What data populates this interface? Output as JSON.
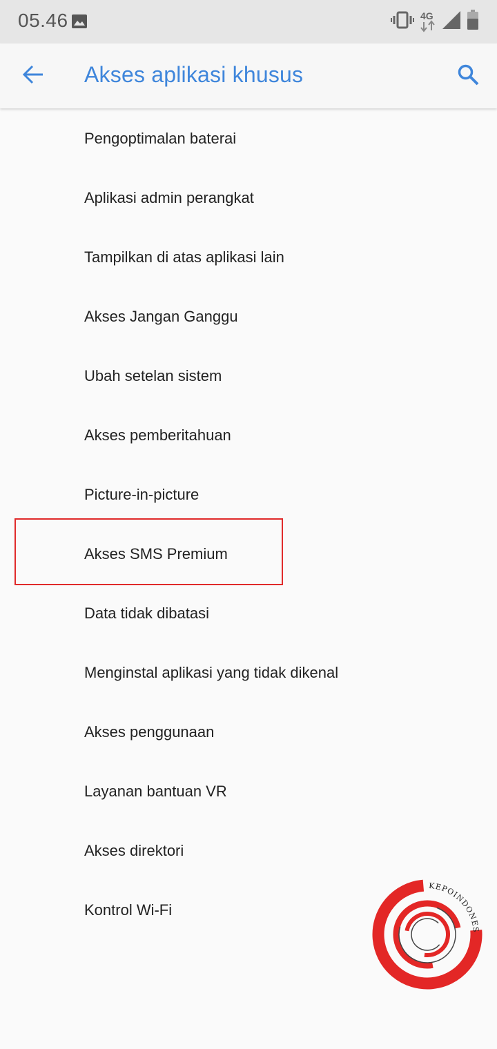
{
  "status_bar": {
    "time": "05.46",
    "left_icon": "image-icon",
    "network_type": "4G",
    "icons": [
      "vibrate-icon",
      "network-type-icon",
      "signal-icon",
      "battery-icon"
    ]
  },
  "toolbar": {
    "title": "Akses aplikasi khusus",
    "back_icon": "arrow-back-icon",
    "search_icon": "search-icon"
  },
  "items": [
    {
      "label": "Pengoptimalan baterai"
    },
    {
      "label": "Aplikasi admin perangkat"
    },
    {
      "label": "Tampilkan di atas aplikasi lain"
    },
    {
      "label": "Akses Jangan Ganggu"
    },
    {
      "label": "Ubah setelan sistem"
    },
    {
      "label": "Akses pemberitahuan"
    },
    {
      "label": "Picture-in-picture"
    },
    {
      "label": "Akses SMS Premium"
    },
    {
      "label": "Data tidak dibatasi"
    },
    {
      "label": "Menginstal aplikasi yang tidak dikenal"
    },
    {
      "label": "Akses penggunaan"
    },
    {
      "label": "Layanan bantuan VR"
    },
    {
      "label": "Akses direktori"
    },
    {
      "label": "Kontrol Wi-Fi"
    }
  ],
  "highlight": {
    "target": "Akses SMS Premium",
    "color": "#e02a2a"
  },
  "watermark": {
    "text": "KEPOINDONESIA",
    "color": "#e32726"
  },
  "colors": {
    "accent": "#3f86db",
    "status_bar_bg": "#e6e6e6",
    "background": "#fafafa",
    "text": "#222222"
  }
}
